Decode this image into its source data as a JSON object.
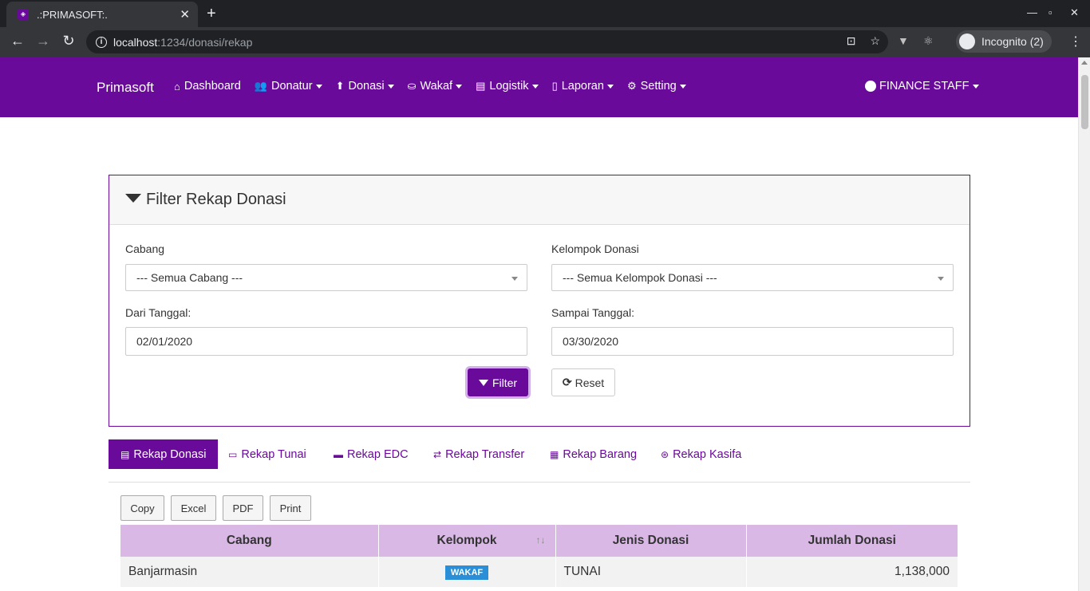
{
  "browser": {
    "tab_title": ".:PRIMASOFT:.",
    "new_tab": "+",
    "url_host": "localhost",
    "url_path": ":1234/donasi/rekap",
    "incognito": "Incognito (2)"
  },
  "navbar": {
    "brand": "Primasoft",
    "items": [
      {
        "label": "Dashboard",
        "icon": "⌂",
        "caret": false
      },
      {
        "label": "Donatur",
        "icon": "👥",
        "caret": true
      },
      {
        "label": "Donasi",
        "icon": "⬆",
        "caret": true
      },
      {
        "label": "Wakaf",
        "icon": "⛀",
        "caret": true
      },
      {
        "label": "Logistik",
        "icon": "▤",
        "caret": true
      },
      {
        "label": "Laporan",
        "icon": "▯",
        "caret": true
      },
      {
        "label": "Setting",
        "icon": "⚙",
        "caret": true
      }
    ],
    "user": "FINANCE STAFF"
  },
  "filter": {
    "title": "Filter Rekap Donasi",
    "cabang_label": "Cabang",
    "cabang_value": "--- Semua Cabang ---",
    "kelompok_label": "Kelompok Donasi",
    "kelompok_value": "--- Semua Kelompok Donasi ---",
    "dari_label": "Dari Tanggal:",
    "dari_value": "02/01/2020",
    "sampai_label": "Sampai Tanggal:",
    "sampai_value": "03/30/2020",
    "filter_btn": "Filter",
    "reset_btn": "Reset"
  },
  "tabs": [
    {
      "label": "Rekap Donasi",
      "icon": "▤",
      "active": true
    },
    {
      "label": "Rekap Tunai",
      "icon": "▭",
      "active": false
    },
    {
      "label": "Rekap EDC",
      "icon": "▬",
      "active": false
    },
    {
      "label": "Rekap Transfer",
      "icon": "⇄",
      "active": false
    },
    {
      "label": "Rekap Barang",
      "icon": "▦",
      "active": false
    },
    {
      "label": "Rekap Kasifa",
      "icon": "⊛",
      "active": false
    }
  ],
  "export_buttons": [
    "Copy",
    "Excel",
    "PDF",
    "Print"
  ],
  "table": {
    "headers": [
      "Cabang",
      "Kelompok",
      "Jenis Donasi",
      "Jumlah Donasi"
    ],
    "rows": [
      {
        "cabang": "Banjarmasin",
        "kelompok": "WAKAF",
        "jenis": "TUNAI",
        "jumlah": "1,138,000"
      }
    ]
  },
  "colors": {
    "primary": "#6a0a9a",
    "header_bg": "#d9b8e6",
    "badge": "#2b8fd8"
  }
}
